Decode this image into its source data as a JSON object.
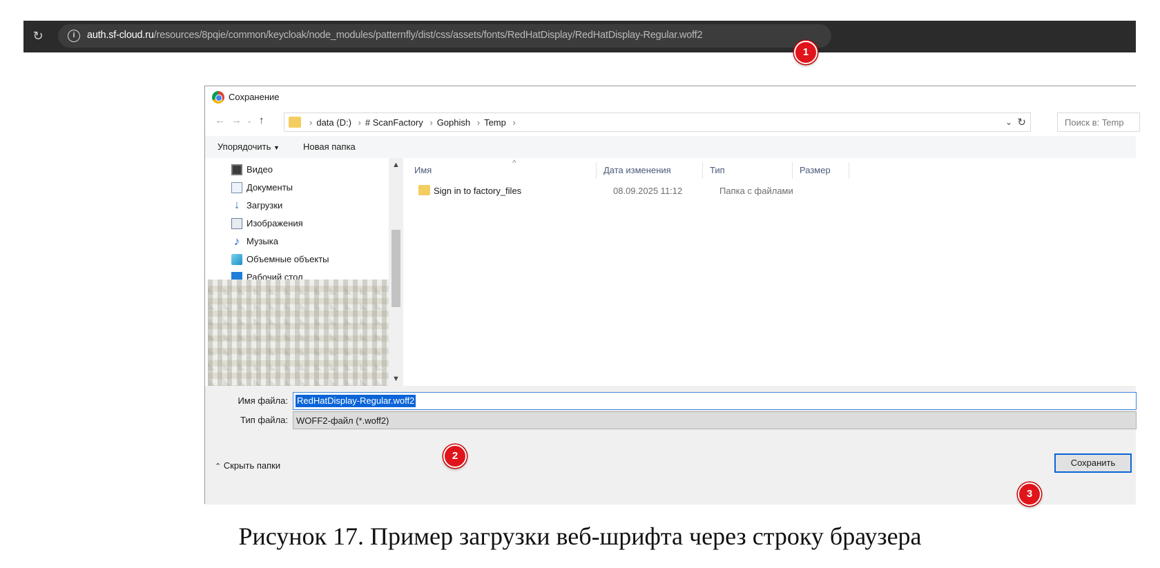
{
  "browser": {
    "url_host": "auth.sf-cloud.ru",
    "url_path": "/resources/8pqie/common/keycloak/node_modules/patternfly/dist/css/assets/fonts/RedHatDisplay/RedHatDisplay-Regular.woff2"
  },
  "markers": [
    "1",
    "2",
    "3"
  ],
  "dialog": {
    "title": "Сохранение",
    "path": {
      "drive": "data (D:)",
      "crumbs": [
        "# ScanFactory",
        "Gophish",
        "Temp"
      ]
    },
    "search_placeholder": "Поиск в: Temp",
    "toolbar": {
      "organize": "Упорядочить",
      "new_folder": "Новая папка"
    },
    "nav_items": [
      {
        "label": "Видео",
        "icon": "video-icon"
      },
      {
        "label": "Документы",
        "icon": "documents-icon"
      },
      {
        "label": "Загрузки",
        "icon": "downloads-icon"
      },
      {
        "label": "Изображения",
        "icon": "images-icon"
      },
      {
        "label": "Музыка",
        "icon": "music-icon"
      },
      {
        "label": "Объемные объекты",
        "icon": "3d-objects-icon"
      },
      {
        "label": "Рабочий стол",
        "icon": "desktop-icon"
      }
    ],
    "columns": {
      "name": "Имя",
      "date": "Дата изменения",
      "type": "Тип",
      "size": "Размер"
    },
    "files": [
      {
        "name": "Sign in to factory_files",
        "date": "08.09.2025 11:12",
        "type": "Папка с файлами",
        "size": ""
      }
    ],
    "filename_label": "Имя файла:",
    "filename_value": "RedHatDisplay-Regular.woff2",
    "filetype_label": "Тип файла:",
    "filetype_value": "WOFF2-файл (*.woff2)",
    "hide_folders": "Скрыть папки",
    "save_button": "Сохранить"
  },
  "caption": "Рисунок 17. Пример загрузки веб-шрифта через строку браузера"
}
